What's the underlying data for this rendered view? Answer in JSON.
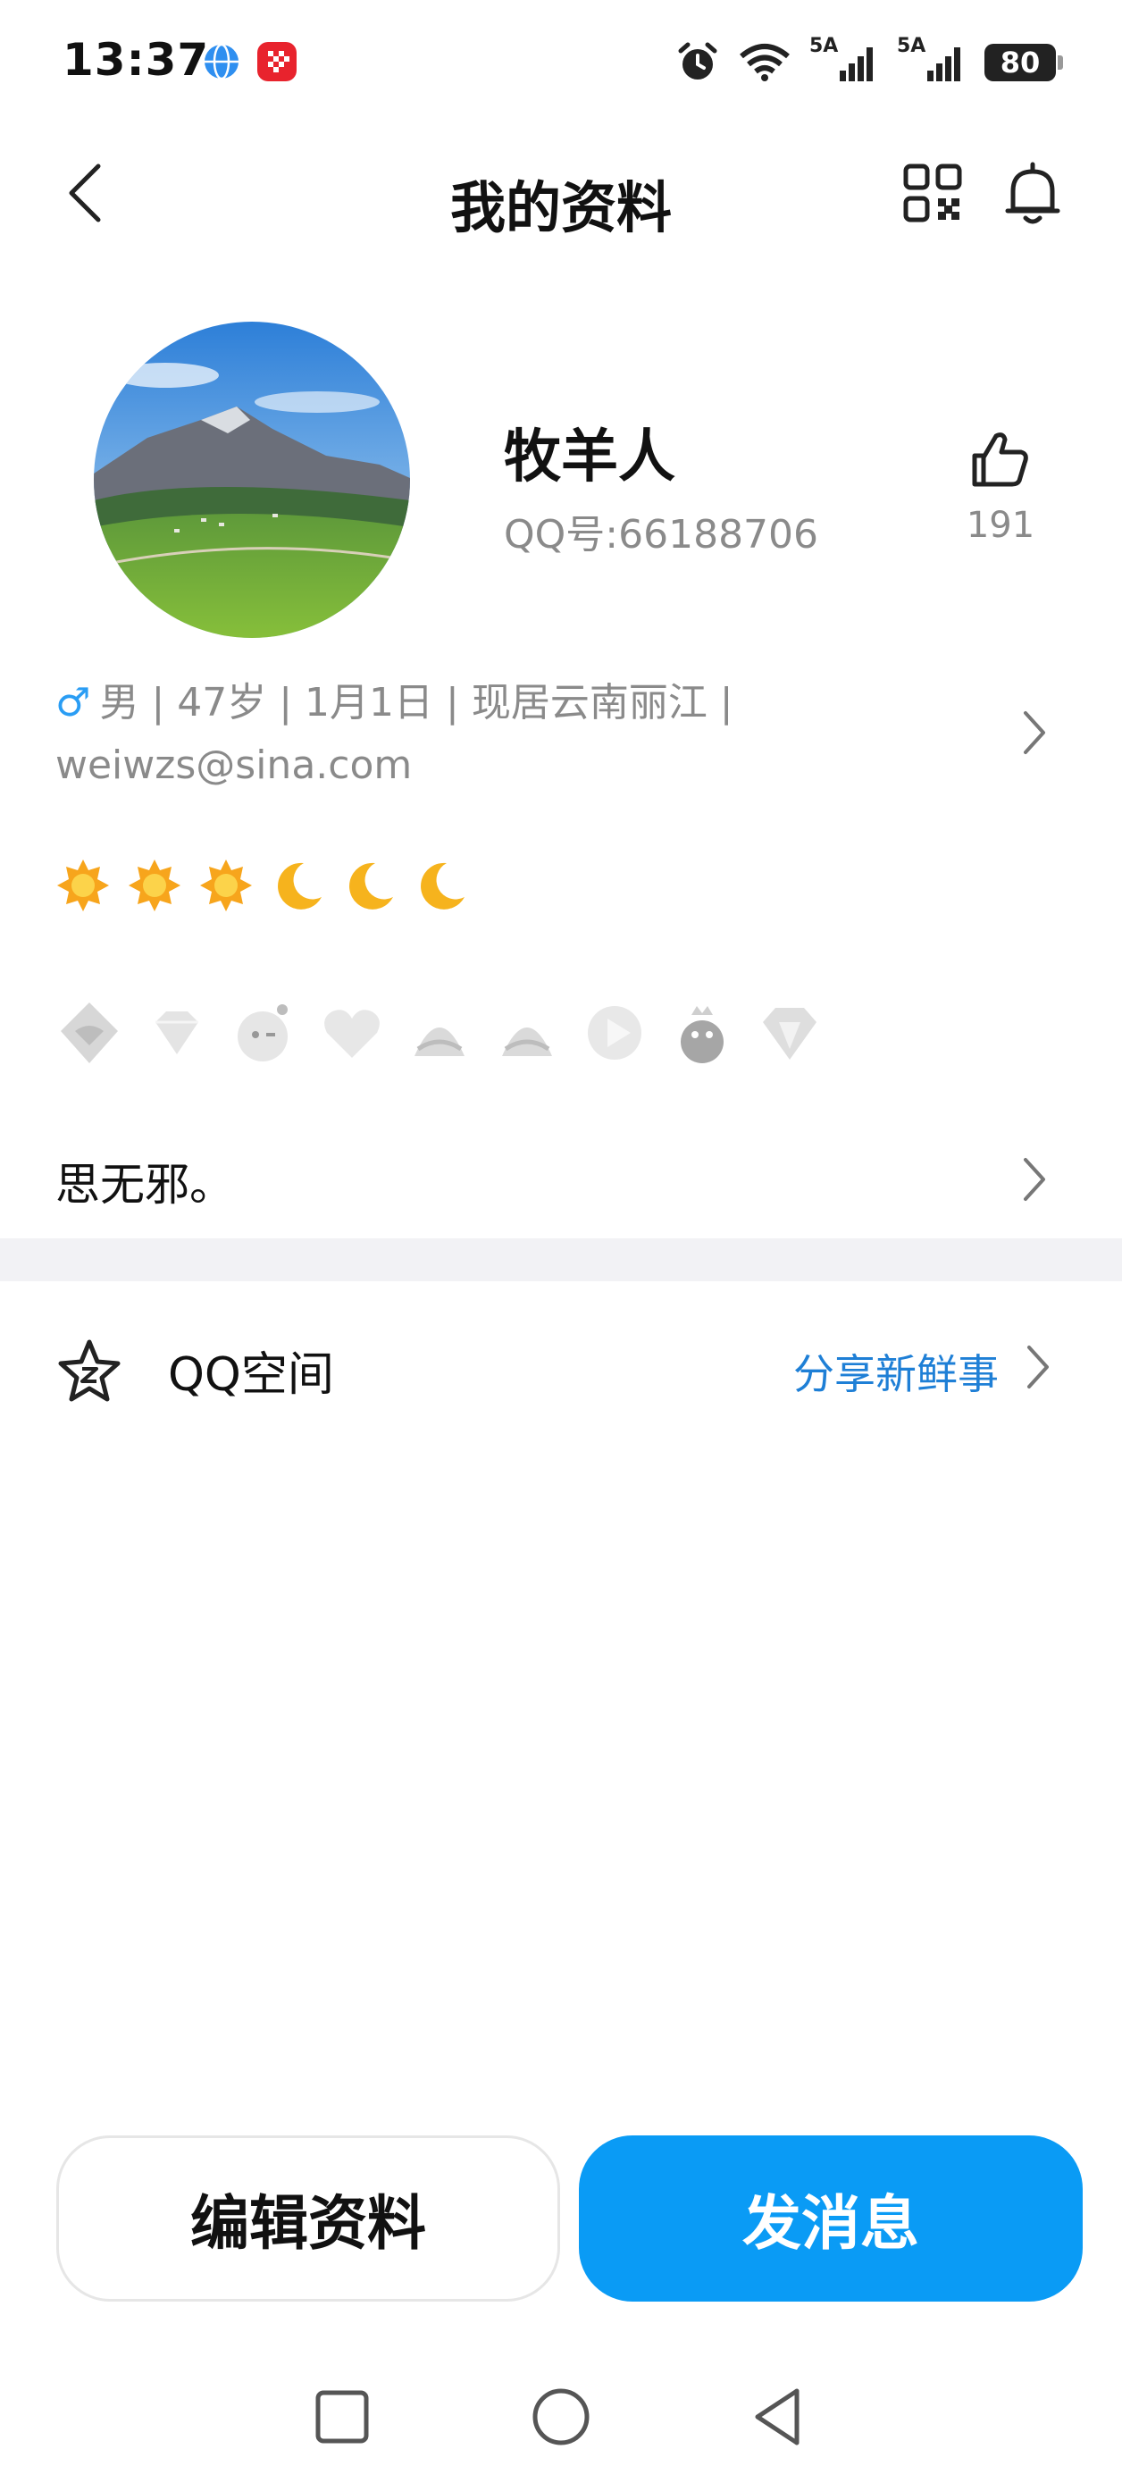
{
  "status_bar": {
    "time": "13:37",
    "battery": "80",
    "signal_1": "5A",
    "signal_2": "5A",
    "icons": [
      "browser-app-icon",
      "red-app-icon",
      "alarm-icon",
      "wifi-icon",
      "cell-signal-icon",
      "cell-signal-icon",
      "battery-icon"
    ]
  },
  "nav": {
    "title": "我的资料",
    "back_icon": "chevron-left-icon",
    "qr_icon": "qr-code-icon",
    "bell_icon": "bell-icon"
  },
  "profile": {
    "nickname": "牧羊人",
    "qq_number": "QQ号:66188706",
    "likes": "191",
    "avatar": "mountain-landscape-avatar"
  },
  "info": {
    "gender_symbol": "♂",
    "line1": "男 | 47岁 | 1月1日 | 现居云南丽江 |",
    "line2": "weiwzs@sina.com"
  },
  "level_badges": [
    "sun-icon",
    "sun-icon",
    "sun-icon",
    "moon-icon",
    "moon-icon",
    "moon-icon"
  ],
  "vip_icons": [
    "vip-icon-1",
    "diamond-icon",
    "bomb-icon",
    "heart-icon",
    "cone-icon-1",
    "cone-icon-2",
    "play-icon",
    "penguin-crown-icon",
    "gem-icon"
  ],
  "signature": "思无邪。",
  "qzone": {
    "label": "QQ空间",
    "action": "分享新鲜事"
  },
  "buttons": {
    "edit": "编辑资料",
    "send": "发消息"
  },
  "colors": {
    "accent": "#0a9bf5",
    "link": "#1e7fd6",
    "muted": "#8a8a8a",
    "gender": "#2a9df4"
  }
}
